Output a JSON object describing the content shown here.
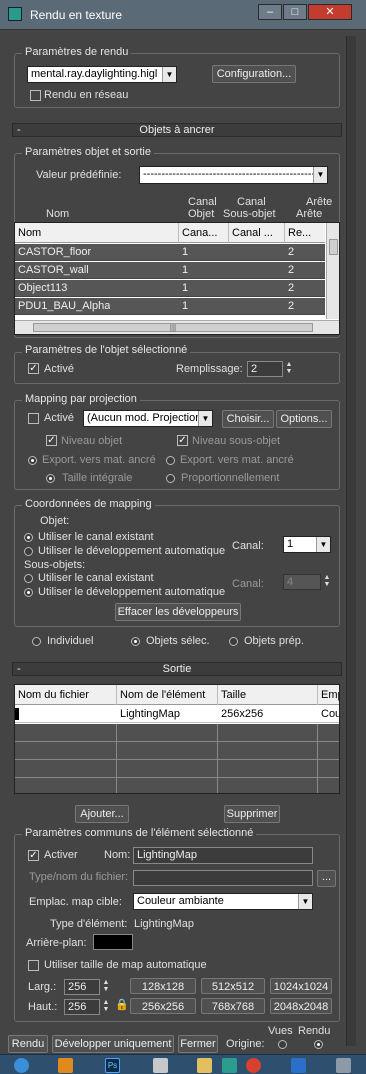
{
  "window": {
    "title": "Rendu en texture"
  },
  "render_settings": {
    "group_label": "Paramètres de rendu",
    "renderer_value": "mental.ray.daylighting.higl",
    "configure_label": "Configuration...",
    "network_label": "Rendu en réseau"
  },
  "objects_rollout": {
    "header": "Objets à ancrer",
    "minus": "-",
    "group_label": "Paramètres objet et sortie",
    "preset_label": "Valeur prédéfinie:",
    "preset_value": "-----------------------------------------------",
    "columns_above": {
      "name": "Nom",
      "object_channel_1": "Canal",
      "object_channel_2": "Objet",
      "sub_channel_1": "Canal",
      "sub_channel_2": "Sous-objet",
      "edge_1": "Arête",
      "edge_2": "Arête"
    },
    "list_headers": [
      "Nom",
      "Cana...",
      "Canal ...",
      "Re..."
    ],
    "rows": [
      [
        "CASTOR_floor",
        "1",
        "",
        "2"
      ],
      [
        "CASTOR_wall",
        "1",
        "",
        "2"
      ],
      [
        "Object113",
        "1",
        "",
        "2"
      ],
      [
        "PDU1_BAU_Alpha",
        "1",
        "",
        "2"
      ]
    ],
    "selected": {
      "group_label": "Paramètres de l'objet sélectionné",
      "enabled_label": "Activé",
      "padding_label": "Remplissage:",
      "padding_value": "2"
    },
    "projection": {
      "group_label": "Mapping par projection",
      "enabled_label": "Activé",
      "modifier_value": "(Aucun mod. Projection",
      "choose_label": "Choisir...",
      "options_label": "Options...",
      "object_level": "Niveau objet",
      "sub_object_level": "Niveau sous-objet",
      "export_1": "Export. vers mat. ancré",
      "export_2": "Export. vers mat. ancré",
      "full_size": "Taille intégrale",
      "proportional": "Proportionnellement"
    },
    "mapping": {
      "group_label": "Coordonnées de mapping",
      "object_label": "Objet:",
      "use_existing": "Utiliser le canal existant",
      "use_auto": "Utiliser le développement automatique",
      "channel_label": "Canal:",
      "channel_value": "1",
      "sub_label": "Sous-objets:",
      "sub_use_existing": "Utiliser le canal existant",
      "sub_use_auto": "Utiliser le développement automatique",
      "sub_channel_label": "Canal:",
      "sub_channel_value": "4",
      "clear_label": "Effacer les développeurs"
    },
    "scope": [
      "Individuel",
      "Objets sélec.",
      "Objets prép."
    ]
  },
  "output_rollout": {
    "header": "Sortie",
    "minus": "-",
    "headers": [
      "Nom du fichier",
      "Nom de l'élément",
      "Taille",
      "Emp"
    ],
    "rows": [
      [
        "",
        "LightingMap",
        "256x256",
        "Coul"
      ]
    ],
    "add_label": "Ajouter...",
    "remove_label": "Supprimer",
    "common": {
      "group_label": "Paramètres communs de l'élément sélectionné",
      "enable_label": "Activer",
      "name_label": "Nom:",
      "name_value": "LightingMap",
      "file_label": "Type/nom du fichier:",
      "file_value": "",
      "browse_label": "...",
      "target_label": "Emplac. map cible:",
      "target_value": "Couleur ambiante",
      "type_label": "Type d'élément:",
      "type_value": "LightingMap",
      "bg_label": "Arrière-plan:",
      "bg_color": "#000000",
      "auto_size_label": "Utiliser taille de map automatique",
      "width_label": "Larg.:",
      "width_value": "256",
      "height_label": "Haut.:",
      "height_value": "256",
      "presets": [
        "128x128",
        "512x512",
        "1024x1024",
        "256x256",
        "768x768",
        "2048x2048"
      ]
    }
  },
  "bottom": {
    "render": "Rendu",
    "unwrap_only": "Développer uniquement",
    "close": "Fermer",
    "origin": "Origine:",
    "views": "Vues",
    "rendered": "Rendu"
  },
  "taskbar": {
    "icons": [
      "ie-icon",
      "media-player-icon",
      "photoshop-icon",
      "app-icon",
      "folder-icon",
      "3dsmax-icon",
      "chrome-icon",
      "outlook-icon",
      "calculator-icon"
    ],
    "labels": {
      "ps": "Ps"
    }
  }
}
